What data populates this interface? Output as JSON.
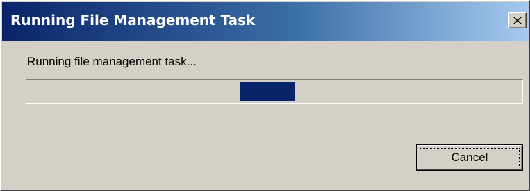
{
  "window": {
    "title": "Running File Management Task",
    "close_icon": "close-icon"
  },
  "dialog": {
    "message": "Running file management task...",
    "progress": {
      "style": "marquee",
      "block_position_fraction": 0.43,
      "block_width_fraction": 0.11,
      "fill_color": "#0a246a"
    },
    "cancel_label": "Cancel"
  },
  "colors": {
    "face": "#d4d0c8",
    "title_start": "#0a246a",
    "title_end": "#a6caf0"
  }
}
